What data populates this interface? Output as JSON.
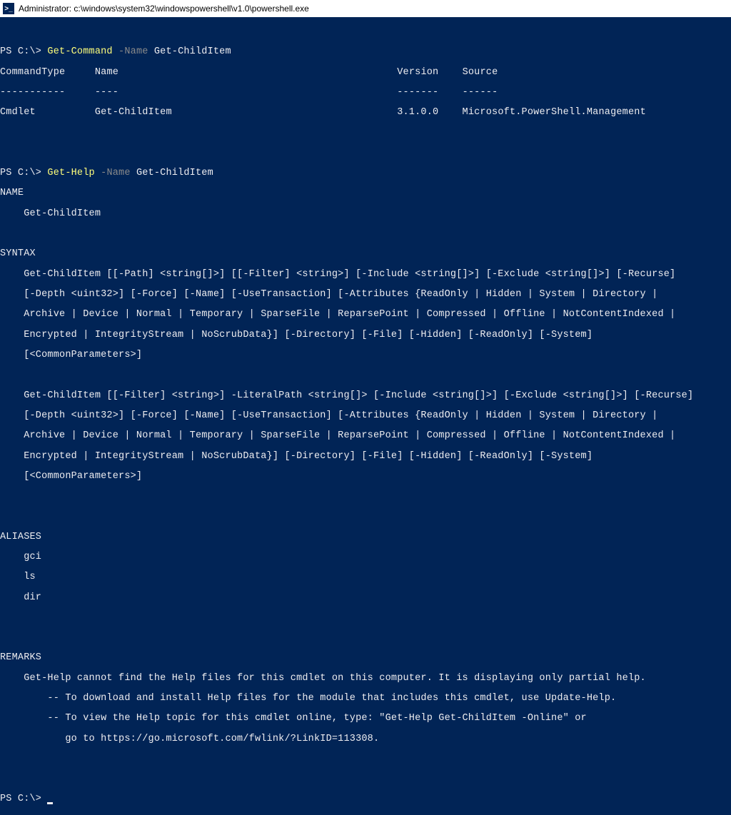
{
  "window": {
    "title": "Administrator: c:\\windows\\system32\\windowspowershell\\v1.0\\powershell.exe",
    "icon_glyph": ">_"
  },
  "cmd1": {
    "prompt": "PS C:\\> ",
    "cmd": "Get-Command ",
    "param": "-Name ",
    "arg": "Get-ChildItem"
  },
  "table": {
    "hdr_commandtype": "CommandType",
    "hdr_name": "Name",
    "hdr_version": "Version",
    "hdr_source": "Source",
    "sep_commandtype": "-----------",
    "sep_name": "----",
    "sep_version": "-------",
    "sep_source": "------",
    "row_commandtype": "Cmdlet",
    "row_name": "Get-ChildItem",
    "row_version": "3.1.0.0",
    "row_source": "Microsoft.PowerShell.Management"
  },
  "cmd2": {
    "prompt": "PS C:\\> ",
    "cmd": "Get-Help ",
    "param": "-Name ",
    "arg": "Get-ChildItem"
  },
  "help": {
    "name_hdr": "NAME",
    "name_val": "    Get-ChildItem",
    "syntax_hdr": "SYNTAX",
    "s1_1": "    Get-ChildItem [[-Path] <string[]>] [[-Filter] <string>] [-Include <string[]>] [-Exclude <string[]>] [-Recurse]",
    "s1_2": "    [-Depth <uint32>] [-Force] [-Name] [-UseTransaction] [-Attributes {ReadOnly | Hidden | System | Directory |",
    "s1_3": "    Archive | Device | Normal | Temporary | SparseFile | ReparsePoint | Compressed | Offline | NotContentIndexed |",
    "s1_4": "    Encrypted | IntegrityStream | NoScrubData}] [-Directory] [-File] [-Hidden] [-ReadOnly] [-System]",
    "s1_5": "    [<CommonParameters>]",
    "s2_1": "    Get-ChildItem [[-Filter] <string>] -LiteralPath <string[]> [-Include <string[]>] [-Exclude <string[]>] [-Recurse]",
    "s2_2": "    [-Depth <uint32>] [-Force] [-Name] [-UseTransaction] [-Attributes {ReadOnly | Hidden | System | Directory |",
    "s2_3": "    Archive | Device | Normal | Temporary | SparseFile | ReparsePoint | Compressed | Offline | NotContentIndexed |",
    "s2_4": "    Encrypted | IntegrityStream | NoScrubData}] [-Directory] [-File] [-Hidden] [-ReadOnly] [-System]",
    "s2_5": "    [<CommonParameters>]",
    "aliases_hdr": "ALIASES",
    "alias1": "    gci",
    "alias2": "    ls",
    "alias3": "    dir",
    "remarks_hdr": "REMARKS",
    "r1": "    Get-Help cannot find the Help files for this cmdlet on this computer. It is displaying only partial help.",
    "r2": "        -- To download and install Help files for the module that includes this cmdlet, use Update-Help.",
    "r3": "        -- To view the Help topic for this cmdlet online, type: \"Get-Help Get-ChildItem -Online\" or",
    "r4": "           go to https://go.microsoft.com/fwlink/?LinkID=113308."
  },
  "cmd3": {
    "prompt": "PS C:\\> "
  }
}
